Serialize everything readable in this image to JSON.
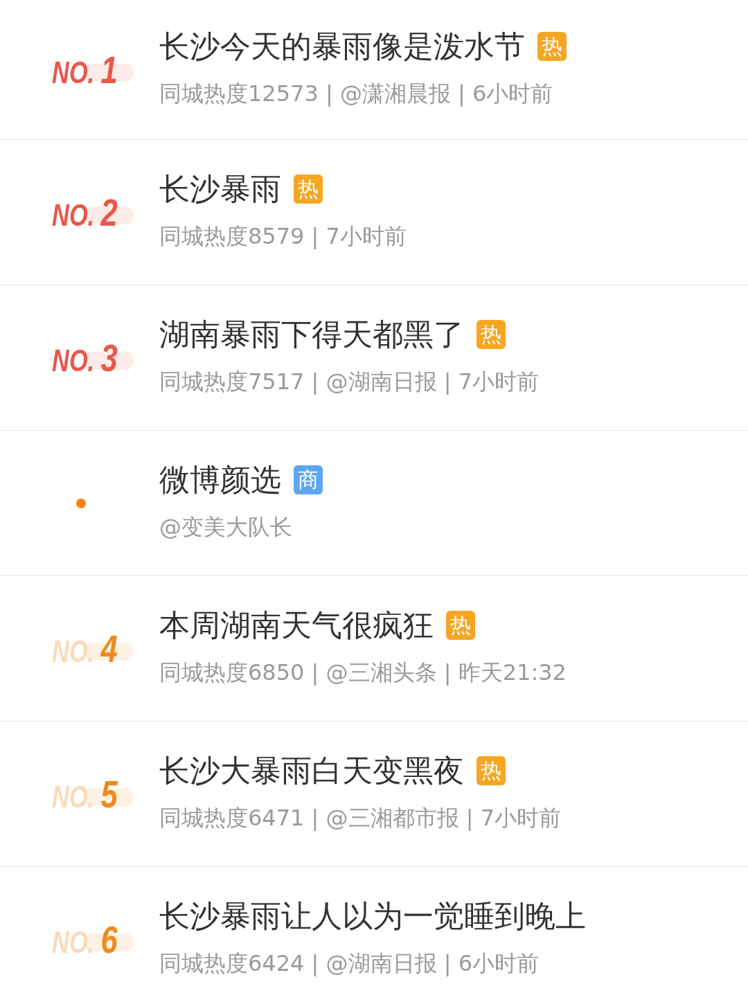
{
  "items": [
    {
      "rank": {
        "kind": "top",
        "prefix": "NO.",
        "number": "1"
      },
      "title": "长沙今天的暴雨像是泼水节",
      "tag": {
        "kind": "hot",
        "label": "热"
      },
      "meta": "同城热度12573 | @潇湘晨报 | 6小时前"
    },
    {
      "rank": {
        "kind": "top",
        "prefix": "NO.",
        "number": "2"
      },
      "title": "长沙暴雨",
      "tag": {
        "kind": "hot",
        "label": "热"
      },
      "meta": "同城热度8579 | 7小时前"
    },
    {
      "rank": {
        "kind": "top",
        "prefix": "NO.",
        "number": "3"
      },
      "title": "湖南暴雨下得天都黑了",
      "tag": {
        "kind": "hot",
        "label": "热"
      },
      "meta": "同城热度7517 | @湖南日报 | 7小时前"
    },
    {
      "rank": {
        "kind": "dot"
      },
      "title": "微博颜选",
      "tag": {
        "kind": "ad",
        "label": "商"
      },
      "meta": "@变美大队长"
    },
    {
      "rank": {
        "kind": "normal",
        "prefix": "NO.",
        "number": "4"
      },
      "title": "本周湖南天气很疯狂",
      "tag": {
        "kind": "hot",
        "label": "热"
      },
      "meta": "同城热度6850 | @三湘头条 | 昨天21:32"
    },
    {
      "rank": {
        "kind": "normal",
        "prefix": "NO.",
        "number": "5"
      },
      "title": "长沙大暴雨白天变黑夜",
      "tag": {
        "kind": "hot",
        "label": "热"
      },
      "meta": "同城热度6471 | @三湘都市报 | 7小时前"
    },
    {
      "rank": {
        "kind": "normal",
        "prefix": "NO.",
        "number": "6"
      },
      "title": "长沙暴雨让人以为一觉睡到晚上",
      "meta": "同城热度6424 | @湖南日报 | 6小时前"
    }
  ]
}
